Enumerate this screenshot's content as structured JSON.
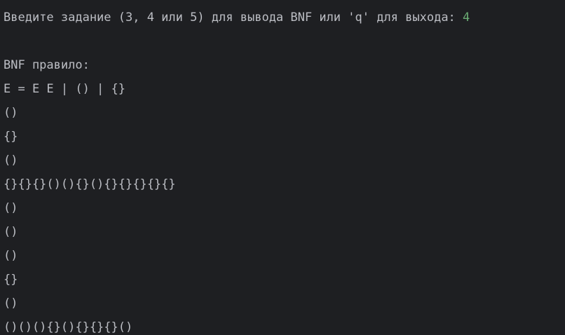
{
  "terminal": {
    "prompt_text": "Введите задание (3, 4 или 5) для вывода BNF или 'q' для выхода: ",
    "user_input": "4",
    "heading": "BNF правило:",
    "rule": "E = E E | () | {}",
    "output_lines": [
      "()",
      "{}",
      "()",
      "{}{}{}()(){}(){}{}{}{}{}",
      "()",
      "()",
      "()",
      "{}",
      "()",
      "()()(){}(){}{}{}()"
    ]
  },
  "colors": {
    "background": "#1e1f22",
    "text": "#bcbec4",
    "input": "#6aab73"
  }
}
